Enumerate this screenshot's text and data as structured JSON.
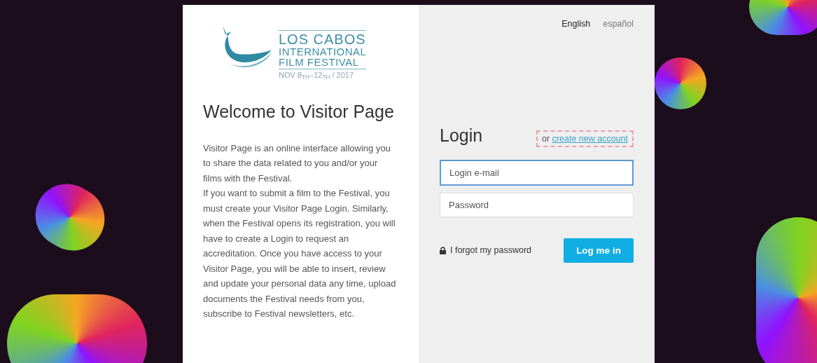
{
  "logo": {
    "lines": [
      "LOS CABOS",
      "INTERNATIONAL",
      "FILM FESTIVAL"
    ],
    "dates": "NOV 8$_{TH}$–12$_{TH}$ / 2017"
  },
  "welcome": {
    "title": "Welcome to Visitor Page",
    "paragraphs": [
      "Visitor Page is an online interface allowing you to share the data related to you and/or your films with the Festival.",
      "If you want to submit a film to the Festival, you must create your Visitor Page Login. Similarly, when the Festival opens its registration, you will have to create a Login to request an accreditation. Once you have access to your Visitor Page, you will be able to insert, review and update your personal data any time, upload documents the Festival needs from you, subscribe to Festival newsletters, etc."
    ]
  },
  "languages": [
    {
      "label": "English",
      "selected": true
    },
    {
      "label": "español",
      "selected": false
    }
  ],
  "login": {
    "title": "Login",
    "or": "or",
    "create_link": "create new account",
    "email": {
      "placeholder": "Login e-mail",
      "focused": true
    },
    "password": {
      "placeholder": "Password",
      "focused": false
    },
    "forgot": "I forgot my password",
    "submit": "Log me in"
  }
}
